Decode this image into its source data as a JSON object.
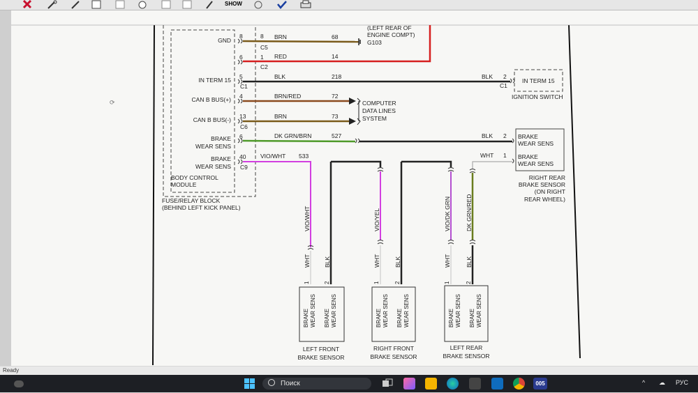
{
  "toolbar": {
    "show_label": "SHOW"
  },
  "statusbar": {
    "text": "Ready"
  },
  "taskbar": {
    "search_placeholder": "Поиск",
    "lang": "РУС",
    "app_badge": "005"
  },
  "diagram": {
    "pins": {
      "gnd": {
        "label": "GND",
        "pin_l": "8",
        "pin_r": "8",
        "conn": "C5",
        "wire": "BRN",
        "circuit": "68"
      },
      "red": {
        "pin_l": "6",
        "pin_r": "1",
        "conn": "C2",
        "wire": "RED",
        "circuit": "14"
      },
      "in15": {
        "label": "IN TERM 15",
        "pin": "5",
        "conn": "C1",
        "wire": "BLK",
        "circuit": "218"
      },
      "canh": {
        "label": "CAN B BUS(+)",
        "pin": "4",
        "wire": "BRN/RED",
        "circuit": "72"
      },
      "canl": {
        "label": "CAN B BUS(-)",
        "pin": "13",
        "conn": "C6",
        "wire": "BRN",
        "circuit": "73"
      },
      "bw1": {
        "label_1": "BRAKE",
        "label_2": "WEAR SENS",
        "pin": "6",
        "wire": "DK GRN/BRN",
        "circuit": "527"
      },
      "bw2": {
        "label_1": "BRAKE",
        "label_2": "WEAR SENS",
        "pin": "40",
        "conn": "C9",
        "wire": "VIO/WHT",
        "circuit": "533"
      }
    },
    "bcm": {
      "line1": "BODY CONTROL",
      "line2": "MODULE"
    },
    "fuse": {
      "line1": "FUSE/RELAY BLOCK",
      "line2": "(BEHIND LEFT KICK PANEL)"
    },
    "ground": {
      "line1": "(LEFT REAR OF",
      "line2": "ENGINE COMPT)",
      "id": "G103"
    },
    "computer": {
      "line1": "COMPUTER",
      "line2": "DATA LINES",
      "line3": "SYSTEM"
    },
    "ignition": {
      "label": "IN TERM 15",
      "title": "IGNITION SWITCH",
      "wire": "BLK",
      "pin": "2",
      "conn": "C1"
    },
    "rr_sensor": {
      "pin1_label_1": "BRAKE",
      "pin1_label_2": "WEAR SENS",
      "pin2_label_1": "BRAKE",
      "pin2_label_2": "WEAR SENS",
      "wire_blk": "BLK",
      "pin_blk": "2",
      "wire_wht": "WHT",
      "pin_wht": "1",
      "title_1": "RIGHT REAR",
      "title_2": "BRAKE SENSOR",
      "title_3": "(ON RIGHT",
      "title_4": "REAR WHEEL)"
    },
    "front_left": {
      "wire_a": "VIO/WHT",
      "wht": "WHT",
      "blk": "BLK",
      "pin1": "1",
      "pin2": "2",
      "title_1": "LEFT FRONT",
      "title_2": "BRAKE SENSOR"
    },
    "front_right": {
      "wire_a": "VIO/YEL",
      "wht": "WHT",
      "blk": "BLK",
      "pin1": "1",
      "pin2": "2",
      "title_1": "RIGHT FRONT",
      "title_2": "BRAKE SENSOR"
    },
    "rear_left": {
      "wire_a": "VIO/DK GRN",
      "wire_b": "DK GRN/RED",
      "wht": "WHT",
      "blk": "BLK",
      "pin1": "1",
      "pin2": "2",
      "title_1": "LEFT REAR",
      "title_2": "BRAKE SENSOR"
    },
    "sensor_box": {
      "l1": "BRAKE",
      "l2": "WEAR SENS"
    }
  }
}
